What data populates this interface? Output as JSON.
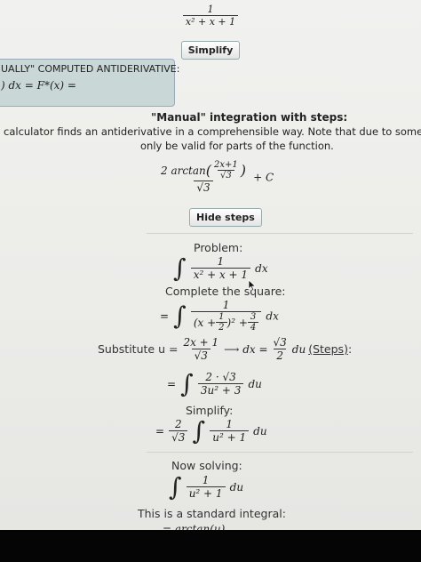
{
  "top_fraction": {
    "numerator": "1",
    "denominator": "x² + x + 1"
  },
  "simplify_button": "Simplify",
  "manual_box": {
    "title": "UALLY\" COMPUTED ANTIDERIVATIVE:",
    "formula": ") dx = F*(x) ="
  },
  "section": {
    "title": "\"Manual\" integration with steps:",
    "description_line1": "calculator finds an antiderivative in a comprehensible way. Note that due to some simplifications, it m",
    "description_line2": "only be valid for parts of the function."
  },
  "result": {
    "numerator_prefix": "2 arctan",
    "inner_numerator": "2x+1",
    "inner_denominator": "√3",
    "denominator": "√3",
    "suffix": "+ C"
  },
  "hide_steps_button": "Hide steps",
  "steps": {
    "problem_label": "Problem:",
    "problem_numerator": "1",
    "problem_denominator": "x² + x + 1",
    "problem_dx": "dx",
    "complete_square_label": "Complete the square:",
    "cs_numerator": "1",
    "cs_den_a": "(x +",
    "cs_half_num": "1",
    "cs_half_den": "2",
    "cs_den_b": ")² +",
    "cs_q_num": "3",
    "cs_q_den": "4",
    "cs_dx": "dx",
    "substitute_label": "Substitute u =",
    "sub_num": "2x + 1",
    "sub_den": "√3",
    "sub_arrow": "⟶ dx =",
    "sub_dx_num": "√3",
    "sub_dx_den": "2",
    "sub_du": "du",
    "sub_steps_link": "(Steps)",
    "sub_colon": ":",
    "int2_num": "2 · √3",
    "int2_den": "3u² + 3",
    "int2_du": "du",
    "simplify_label": "Simplify:",
    "simp_coef_num": "2",
    "simp_coef_den": "√3",
    "simp_num": "1",
    "simp_den": "u² + 1",
    "simp_du": "du",
    "now_solving_label": "Now solving:",
    "ns_num": "1",
    "ns_den": "u² + 1",
    "ns_du": "du",
    "standard_integral_label": "This is a standard integral:",
    "last_line": "= arctan(u)"
  }
}
